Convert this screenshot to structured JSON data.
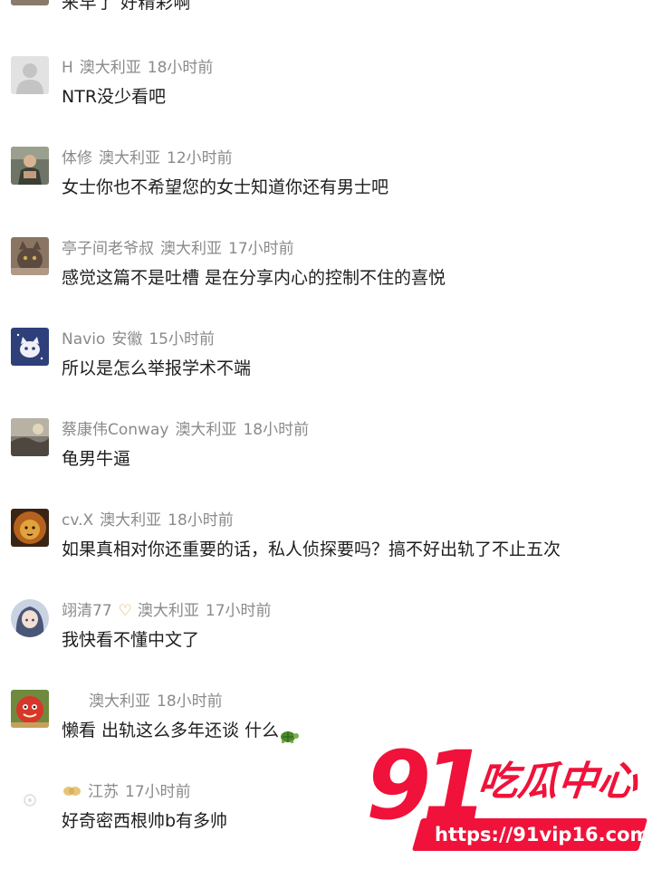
{
  "partial_top_text": "来早了 好精彩啊",
  "comments": [
    {
      "user": "H",
      "location": "澳大利亚",
      "time": "18小时前",
      "text": "NTR没少看吧",
      "avatar_icon": "default-avatar-icon"
    },
    {
      "user": "体修",
      "location": "澳大利亚",
      "time": "12小时前",
      "text": "女士你也不希望您的女士知道你还有男士吧",
      "avatar_icon": "person-photo-avatar"
    },
    {
      "user": "亭子间老爷叔",
      "location": "澳大利亚",
      "time": "17小时前",
      "text": "感觉这篇不是吐槽 是在分享内心的控制不住的喜悦",
      "avatar_icon": "cat-photo-avatar"
    },
    {
      "user": "Navio",
      "location": "安徽",
      "time": "15小时前",
      "text": "所以是怎么举报学术不端",
      "avatar_icon": "cartoon-cat-avatar"
    },
    {
      "user": "蔡康伟Conway",
      "location": "澳大利亚",
      "time": "18小时前",
      "text": "龟男牛逼",
      "avatar_icon": "landscape-photo-avatar"
    },
    {
      "user": "cv.X",
      "location": "澳大利亚",
      "time": "18小时前",
      "text": "如果真相对你还重要的话，私人侦探要吗？搞不好出轨了不止五次",
      "avatar_icon": "lion-avatar"
    },
    {
      "user": "翊清77",
      "badge": "♡",
      "location": "澳大利亚",
      "time": "17小时前",
      "text": "我快看不懂中文了",
      "avatar_icon": "anime-girl-avatar"
    },
    {
      "user": "",
      "location": "澳大利亚",
      "time": "18小时前",
      "text": "懒看 出轨这么多年还谈 什么",
      "avatar_icon": "red-cartoon-avatar",
      "emoji": "turtle-emoji-icon"
    },
    {
      "user": "",
      "location": "江苏",
      "time": "17小时前",
      "text": "好奇密西根帅b有多帅",
      "avatar_icon": "faded-avatar",
      "user_emoji": "peanut-emoji-icon"
    }
  ],
  "watermark": {
    "number": "91",
    "title": "吃瓜中心",
    "url": "https://91vip16.com",
    "color": "#f0123a"
  }
}
